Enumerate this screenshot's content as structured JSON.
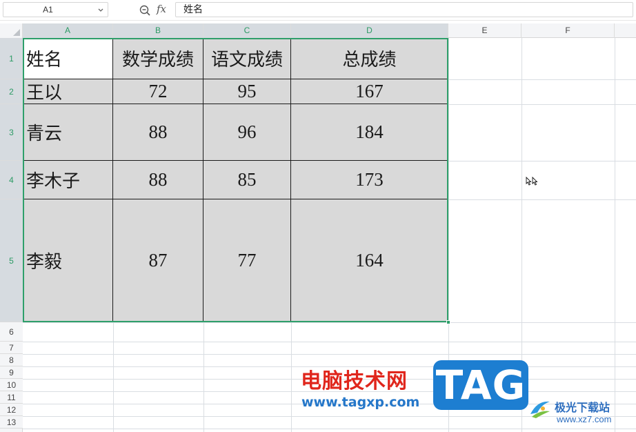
{
  "formula_bar": {
    "name_box": "A1",
    "fx_label": "fx",
    "formula_value": "姓名"
  },
  "columns": [
    "A",
    "B",
    "C",
    "D",
    "E",
    "F"
  ],
  "rows": [
    "1",
    "2",
    "3",
    "4",
    "5",
    "6",
    "7",
    "8",
    "9",
    "10",
    "11",
    "12",
    "13"
  ],
  "table": {
    "headers": [
      "姓名",
      "数学成绩",
      "语文成绩",
      "总成绩"
    ],
    "records": [
      {
        "name": "王以",
        "math": "72",
        "chinese": "95",
        "total": "167"
      },
      {
        "name": "青云",
        "math": "88",
        "chinese": "96",
        "total": "184"
      },
      {
        "name": "李木子",
        "math": "88",
        "chinese": "85",
        "total": "173"
      },
      {
        "name": "李毅",
        "math": "87",
        "chinese": "77",
        "total": "164"
      }
    ]
  },
  "selection": {
    "active_cell": "A1",
    "range": "A1:D5"
  },
  "colors": {
    "selection_green": "#2e9f6a",
    "cell_fill": "#d9d9d9",
    "watermark_red": "#e0261c",
    "watermark_blue": "#1d7ed1"
  },
  "watermark": {
    "site_name_cn": "电脑技术网",
    "site_url": "www.tagxp.com",
    "badge": "TAG",
    "partner_name": "极光下载站",
    "partner_url": "www.xz7.com"
  }
}
